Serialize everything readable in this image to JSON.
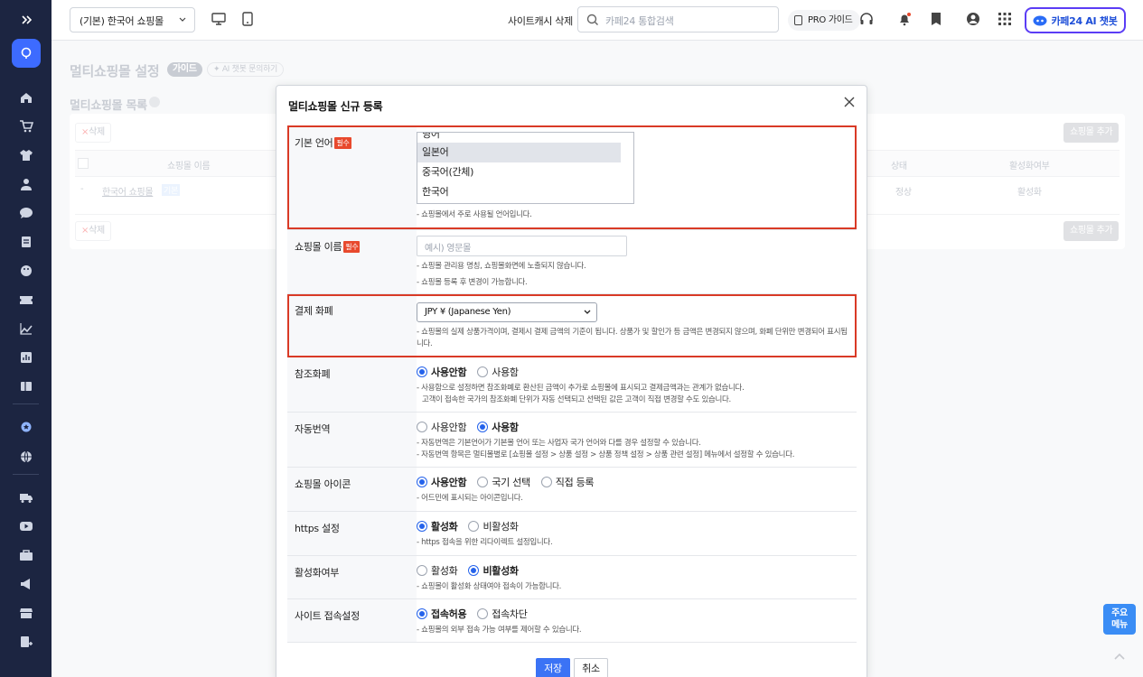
{
  "topbar": {
    "shop_select": "(기본) 한국어 쇼핑몰",
    "cache_delete": "사이트캐시 삭제",
    "search_placeholder": "카페24 통합검색",
    "pro_guide": "PRO 가이드",
    "ai_chat": "카페24 AI 챗봇"
  },
  "page": {
    "title": "멀티쇼핑몰 설정",
    "guide_badge": "가이드",
    "ai_ask": "AI 챗봇 문의하기",
    "list_title": "멀티쇼핑몰 목록"
  },
  "list": {
    "delete_label": "삭제",
    "add_label": "쇼핑몰 추가",
    "columns": [
      "쇼핑몰 이름",
      "상태",
      "활성화여부"
    ],
    "rows": [
      {
        "mark": "-",
        "name": "한국어 쇼핑몰",
        "tag": "기본",
        "status": "정상",
        "active": "활성화"
      }
    ]
  },
  "modal": {
    "title": "멀티쇼핑몰 신규 등록",
    "required_label": "필수",
    "base_language": {
      "label": "기본 언어",
      "options": [
        "영어",
        "일본어",
        "중국어(간체)",
        "한국어"
      ],
      "selected": "일본어",
      "help": "- 쇼핑몰에서 주로 사용될 언어입니다."
    },
    "shop_name": {
      "label": "쇼핑몰 이름",
      "placeholder": "예시) 영문몰",
      "help1": "- 쇼핑몰 관리용 명칭, 쇼핑몰화면에 노출되지 않습니다.",
      "help2": "- 쇼핑몰 등록 후 변경이 가능합니다."
    },
    "currency": {
      "label": "결제 화폐",
      "value": "JPY ¥ (Japanese Yen)",
      "help": "- 쇼핑몰의 실제 상품가격이며, 결제시 결제 금액의 기준이 됩니다. 상품가 및 할인가 등 금액은 변경되지 않으며, 화폐 단위만 변경되어 표시됩니다."
    },
    "ref_currency": {
      "label": "참조화폐",
      "options": [
        "사용안함",
        "사용함"
      ],
      "selected": 0,
      "help1": "- 사용함으로 설정하면 참조화폐로 환산된 금액이 추가로 쇼핑몰에 표시되고 결제금액과는 관계가 없습니다.",
      "help2": "고객이 접속한 국가의 참조화폐 단위가 자동 선택되고 선택된 값은 고객이 직접 변경할 수도 있습니다."
    },
    "auto_translate": {
      "label": "자동번역",
      "options": [
        "사용안함",
        "사용함"
      ],
      "selected": 1,
      "help1": "- 자동번역은 기본언어가 기본몰 언어 또는 사업자 국가 언어와 다를 경우 설정할 수 있습니다.",
      "help2": "- 자동번역 항목은 멀티몰별로 [쇼핑몰 설정 > 상품 설정 > 상품 정책 설정 > 상품 관련 설정] 메뉴에서 설정할 수 있습니다."
    },
    "shop_icon": {
      "label": "쇼핑몰 아이콘",
      "options": [
        "사용안함",
        "국기 선택",
        "직접 등록"
      ],
      "selected": 0,
      "help": "- 어드민에 표시되는 아이콘입니다."
    },
    "https": {
      "label": "https 설정",
      "options": [
        "활성화",
        "비활성화"
      ],
      "selected": 0,
      "help": "- https 접속을 위한 리다이렉트 설정입니다."
    },
    "activation": {
      "label": "활성화여부",
      "options": [
        "활성화",
        "비활성화"
      ],
      "selected": 1,
      "help": "- 쇼핑몰이 활성화 상태여야 접속이 가능합니다."
    },
    "site_access": {
      "label": "사이트 접속설정",
      "options": [
        "접속허용",
        "접속차단"
      ],
      "selected": 0,
      "help": "- 쇼핑몰의 외부 접속 가능 여부를 제어할 수 있습니다."
    },
    "save": "저장",
    "cancel": "취소"
  },
  "floating": {
    "main_menu": "주요\n메뉴"
  },
  "colors": {
    "sidebar": "#1c2541",
    "accent": "#3b73f5",
    "highlight_border": "#d93a26",
    "ai_border": "#5b3df5"
  }
}
